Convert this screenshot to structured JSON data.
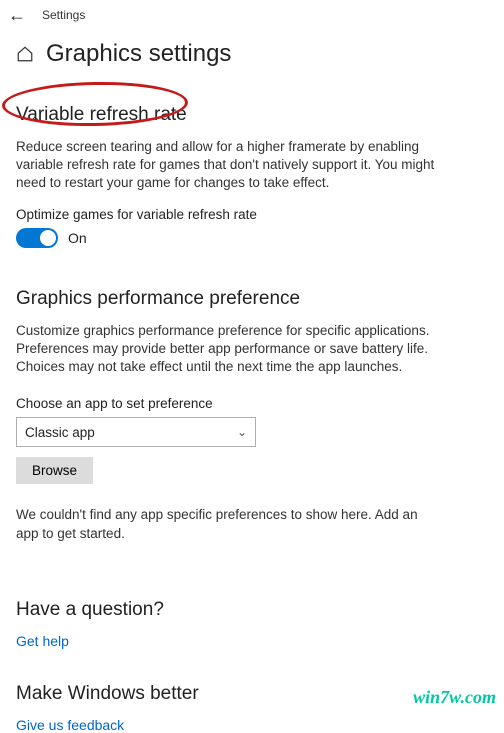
{
  "header": {
    "app_title": "Settings",
    "page_title": "Graphics settings"
  },
  "vrr": {
    "heading": "Variable refresh rate",
    "description": "Reduce screen tearing and allow for a higher framerate by enabling variable refresh rate for games that don't natively support it. You might need to restart your game for changes to take effect.",
    "toggle_label": "Optimize games for variable refresh rate",
    "toggle_state": "On"
  },
  "perf": {
    "heading": "Graphics performance preference",
    "description": "Customize graphics performance preference for specific applications. Preferences may provide better app performance or save battery life. Choices may not take effect until the next time the app launches.",
    "choose_label": "Choose an app to set preference",
    "select_value": "Classic app",
    "browse_label": "Browse",
    "empty_text": "We couldn't find any app specific preferences to show here. Add an app to get started."
  },
  "help": {
    "heading": "Have a question?",
    "link": "Get help"
  },
  "feedback": {
    "heading": "Make Windows better",
    "link": "Give us feedback"
  },
  "watermark": "win7w.com"
}
